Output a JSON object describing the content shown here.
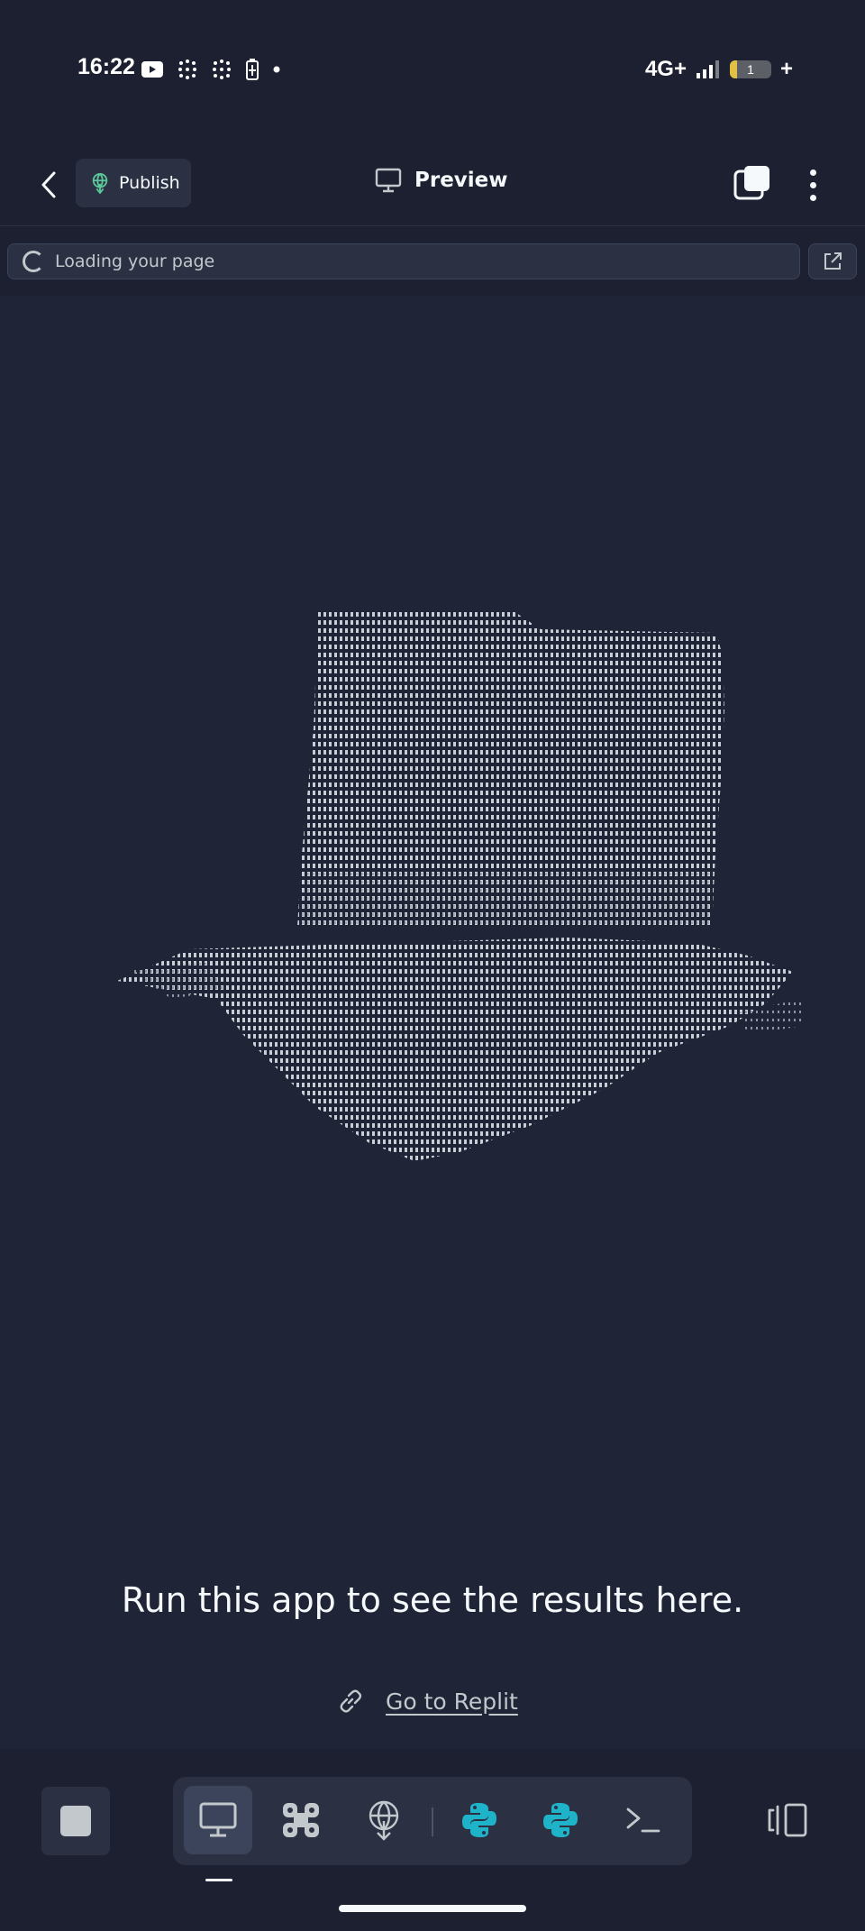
{
  "status_bar": {
    "time": "16:22",
    "network": "4G+",
    "battery_level": "1",
    "icons": [
      "youtube-icon",
      "grid-dots-icon",
      "grid-dots-icon",
      "battery-saver-icon",
      "dot-icon",
      "signal-icon",
      "battery-icon"
    ]
  },
  "header": {
    "publish_label": "Publish",
    "preview_label": "Preview",
    "icons": [
      "back-chevron-icon",
      "publish-icon",
      "monitor-icon",
      "tabs-icon",
      "more-vertical-icon"
    ]
  },
  "address_bar": {
    "status_text": "Loading your page",
    "icons": [
      "loading-spinner-icon",
      "external-link-icon"
    ]
  },
  "preview": {
    "art": "ascii-art-top-hat",
    "message": "Run this app to see the results here.",
    "link_label": "Go to Replit",
    "icons": [
      "link-icon"
    ]
  },
  "toolbar": {
    "items": [
      "stop",
      "desktop-preview",
      "workspace",
      "deployments",
      "python",
      "python",
      "shell",
      "panel-toggle"
    ],
    "active_item": "desktop-preview",
    "accent_color": "#f5f9fc",
    "python_color": "#1fb3c9"
  },
  "colors": {
    "background": "#1c2030",
    "surface": "#2b3142",
    "text": "#f5f9fc",
    "muted": "#c2c8cc"
  }
}
